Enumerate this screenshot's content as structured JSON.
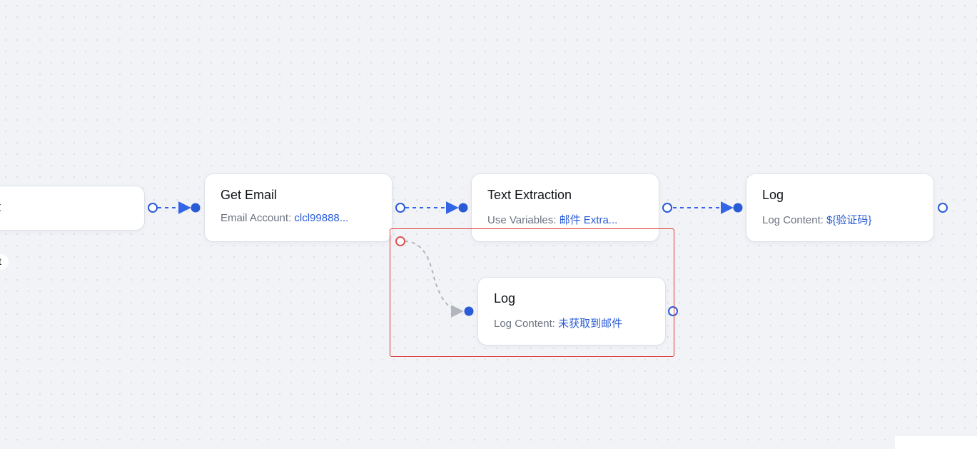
{
  "nodes": [
    {
      "id": "start",
      "title": "t",
      "sub_label": "",
      "sub_value": ""
    },
    {
      "id": "get-email",
      "title": "Get Email",
      "sub_label": "Email Account: ",
      "sub_value": "clcl99888",
      "truncated": true
    },
    {
      "id": "text-extraction",
      "title": "Text Extraction",
      "sub_label": "Use Variables: ",
      "sub_value": "邮件 Extra",
      "truncated": true
    },
    {
      "id": "log-main",
      "title": "Log",
      "sub_label": "Log Content: ",
      "sub_value": "${验证码}"
    },
    {
      "id": "log-branch",
      "title": "Log",
      "sub_label": "Log Content: ",
      "sub_value": "未获取到邮件"
    }
  ],
  "ellipsis": "...",
  "partial_label": "t",
  "colors": {
    "accent": "#2a5bd7",
    "edge": "#3366e6",
    "error_edge": "#b3b6bd",
    "error_handle": "#e05252",
    "selection": "#e03434"
  }
}
